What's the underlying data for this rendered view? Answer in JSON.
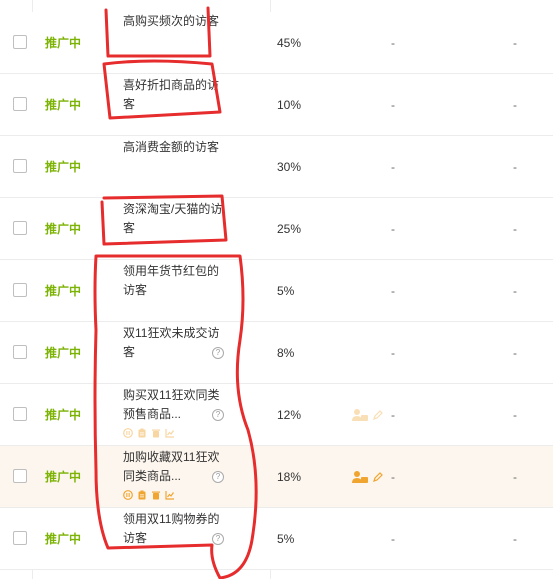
{
  "colors": {
    "status": "#7cb305",
    "annotation": "#e62c2c",
    "tool_icon": "#f0a530"
  },
  "rows": [
    {
      "status": "推广中",
      "name": "高购买频次的访客",
      "ratio": "45%",
      "col5": "-",
      "col6": "-"
    },
    {
      "status": "推广中",
      "name": "喜好折扣商品的访客",
      "ratio": "10%",
      "col5": "-",
      "col6": "-"
    },
    {
      "status": "推广中",
      "name": "高消费金额的访客",
      "ratio": "30%",
      "col5": "-",
      "col6": "-"
    },
    {
      "status": "推广中",
      "name": "资深淘宝/天猫的访客",
      "ratio": "25%",
      "col5": "-",
      "col6": "-"
    },
    {
      "status": "推广中",
      "name": "领用年货节红包的访客",
      "ratio": "5%",
      "col5": "-",
      "col6": "-"
    },
    {
      "status": "推广中",
      "name": "双11狂欢未成交访客",
      "ratio": "8%",
      "col5": "-",
      "col6": "-"
    },
    {
      "status": "推广中",
      "name": "购买双11狂欢同类预售商品...",
      "ratio": "12%",
      "col5": "-",
      "col6": "-"
    },
    {
      "status": "推广中",
      "name": "加购收藏双11狂欢同类商品...",
      "ratio": "18%",
      "col5": "-",
      "col6": "-"
    },
    {
      "status": "推广中",
      "name": "领用双11购物券的访客",
      "ratio": "5%",
      "col5": "-",
      "col6": "-"
    }
  ],
  "help_glyph": "?"
}
